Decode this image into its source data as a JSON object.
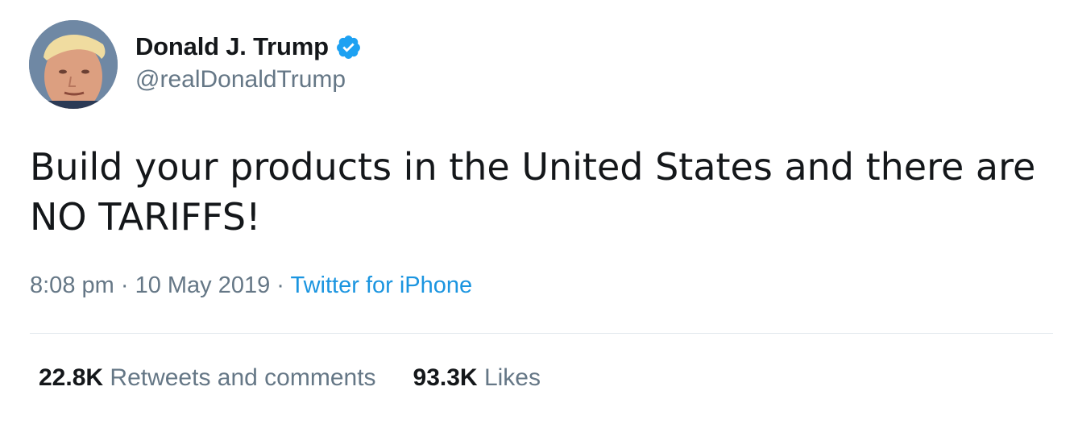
{
  "user": {
    "display_name": "Donald J. Trump",
    "handle": "@realDonaldTrump",
    "verified_icon": "verified-badge-icon",
    "avatar_icon": "avatar-photo"
  },
  "tweet": {
    "line1": "Build your products in the United States and there are",
    "line2": "NO TARIFFS!"
  },
  "meta": {
    "time": "8:08 pm",
    "sep1": " · ",
    "date": "10 May 2019",
    "sep2": " · ",
    "source": "Twitter for iPhone"
  },
  "stats": {
    "retweets_count": "22.8K",
    "retweets_label": " Retweets and comments",
    "likes_count": "93.3K",
    "likes_label": " Likes"
  },
  "colors": {
    "verified_blue": "#1da1f2",
    "link_blue": "#1b95e0",
    "secondary_text": "#657786",
    "divider": "#e1e8ed"
  }
}
